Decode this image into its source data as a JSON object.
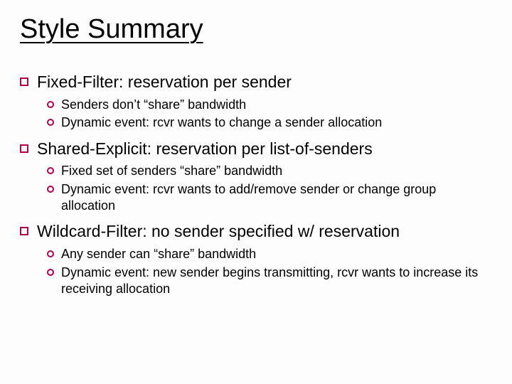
{
  "title": "Style Summary",
  "sections": [
    {
      "heading": "Fixed-Filter: reservation per sender",
      "subs": [
        "Senders don’t “share” bandwidth",
        "Dynamic event: rcvr wants to change a sender allocation"
      ]
    },
    {
      "heading": "Shared-Explicit: reservation per list-of-senders",
      "subs": [
        "Fixed set of senders “share” bandwidth",
        "Dynamic event: rcvr wants to add/remove sender or change group allocation"
      ]
    },
    {
      "heading": "Wildcard-Filter: no sender specified w/ reservation",
      "subs": [
        "Any sender can “share” bandwidth",
        "Dynamic event: new sender begins transmitting, rcvr wants to increase its receiving allocation"
      ]
    }
  ]
}
